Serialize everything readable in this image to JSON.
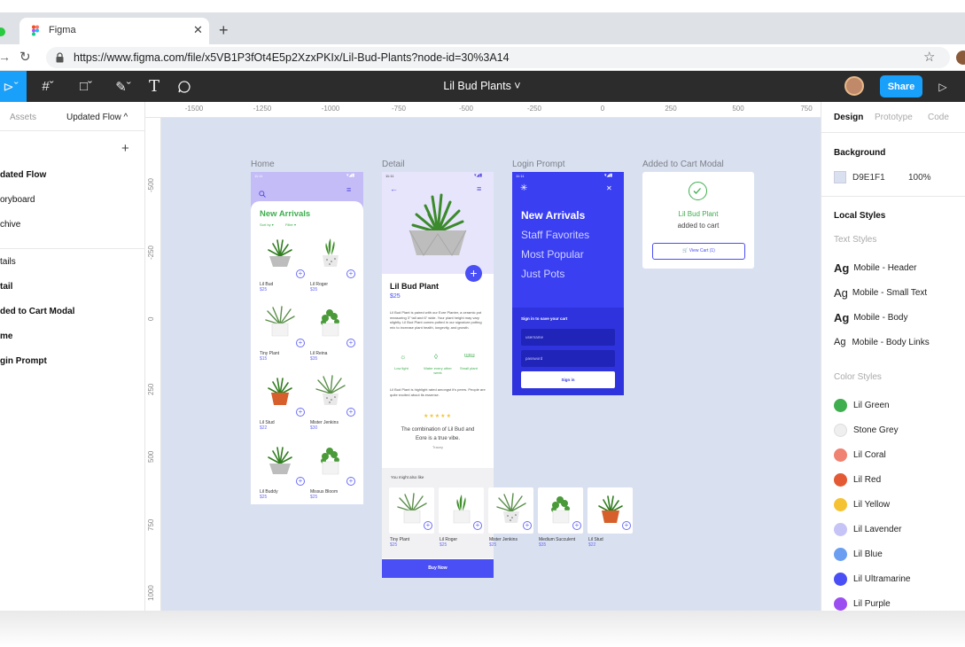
{
  "browser": {
    "tab_title": "Figma",
    "url": "https://www.figma.com/file/x5VB1P3fOt4E5p2XzxPKIx/Lil-Bud-Plants?node-id=30%3A14"
  },
  "toolbar": {
    "file_name": "Lil Bud Plants ˅",
    "share_label": "Share"
  },
  "left_panel": {
    "tab_assets": "Assets",
    "tab_pages": "Updated Flow ^",
    "pages": [
      "dated Flow",
      "oryboard",
      "chive"
    ],
    "layers": [
      "tails",
      "tail",
      "ded to Cart Modal",
      "me",
      "gin Prompt"
    ]
  },
  "rulers": {
    "top": [
      "-1500",
      "-1250",
      "-1000",
      "-750",
      "-500",
      "-250",
      "0",
      "250",
      "500",
      "750"
    ],
    "left": [
      "-500",
      "-250",
      "0",
      "250",
      "500",
      "750",
      "1000"
    ]
  },
  "frames": {
    "home": {
      "label": "Home",
      "status_time": "11:11",
      "title": "New Arrivals",
      "sort": "Sort by ▾",
      "filter": "Filter ▾",
      "products": [
        {
          "name": "Lil Bud",
          "price": "$25"
        },
        {
          "name": "Lil Roger",
          "price": "$35"
        },
        {
          "name": "Tiny Plant",
          "price": "$15"
        },
        {
          "name": "Lil Reina",
          "price": "$35"
        },
        {
          "name": "Lil Stud",
          "price": "$22"
        },
        {
          "name": "Mister Jenkins",
          "price": "$30"
        },
        {
          "name": "Lil Buddy",
          "price": "$25"
        },
        {
          "name": "Missus Bloom",
          "price": "$25"
        }
      ]
    },
    "detail": {
      "label": "Detail",
      "status_time": "11:11",
      "name": "Lil Bud Plant",
      "price": "$25",
      "desc": "Lil Bud Plant is paired with our Eore Planter, a ceramic pot measuring 3\" tall and 6\" wide. Your plant height may vary slightly. Lil Bud Plant comes potted in our signature potting mix to increase plant health, longevity, and growth.",
      "feature1": "Low light",
      "feature2": "Water every other week",
      "feature3": "Small plant",
      "note": "Lil Bud Plant is highlight rated amongst it's peers. People are quite excited about its essense.",
      "stars": "★★★★★",
      "quote": "The combination of Lil Bud and Eore is a true vibe.",
      "quote_author": "Tracey",
      "also_like": "You might also like",
      "also": [
        {
          "name": "Tiny Plant",
          "price": "$25"
        },
        {
          "name": "Lil Roger",
          "price": "$25"
        },
        {
          "name": "Mister Jenkins",
          "price": "$25"
        },
        {
          "name": "Medium Succulent",
          "price": "$35"
        },
        {
          "name": "Lil Stud",
          "price": "$22"
        }
      ],
      "buy": "Buy Now"
    },
    "login": {
      "label": "Login Prompt",
      "status_time": "11:11",
      "menu": [
        "New Arrivals",
        "Staff Favorites",
        "Most Popular",
        "Just Pots"
      ],
      "signin_heading": "Sign in to save your cart",
      "username": "username",
      "password": "password",
      "signin": "Sign in"
    },
    "modal": {
      "label": "Added to Cart Modal",
      "product": "Lil Bud Plant",
      "added": "added to cart",
      "view_cart": "🛒 View Cart (1)"
    }
  },
  "right_panel": {
    "tabs": [
      "Design",
      "Prototype",
      "Code"
    ],
    "background_heading": "Background",
    "bg_hex": "D9E1F1",
    "bg_opacity": "100%",
    "local_styles": "Local Styles",
    "text_styles_heading": "Text Styles",
    "text_styles": [
      "Mobile - Header",
      "Mobile - Small Text",
      "Mobile - Body",
      "Mobile - Body Links"
    ],
    "color_styles_heading": "Color Styles",
    "color_styles": [
      {
        "name": "Lil Green",
        "color": "#3fae4f"
      },
      {
        "name": "Stone Grey",
        "color": "#efefef"
      },
      {
        "name": "Lil Coral",
        "color": "#ef8270"
      },
      {
        "name": "Lil Red",
        "color": "#e35a35"
      },
      {
        "name": "Lil Yellow",
        "color": "#f5c233"
      },
      {
        "name": "Lil Lavender",
        "color": "#c6c3f7"
      },
      {
        "name": "Lil Blue",
        "color": "#6b9ef0"
      },
      {
        "name": "Lil Ultramarine",
        "color": "#4a4ef5"
      },
      {
        "name": "Lil Purple",
        "color": "#9b4ff0"
      }
    ]
  },
  "colors": {
    "canvas": "#D9E1F1",
    "accent": "#18a0fb",
    "ultramarine": "#3a3ff2",
    "green": "#3fae4f"
  }
}
